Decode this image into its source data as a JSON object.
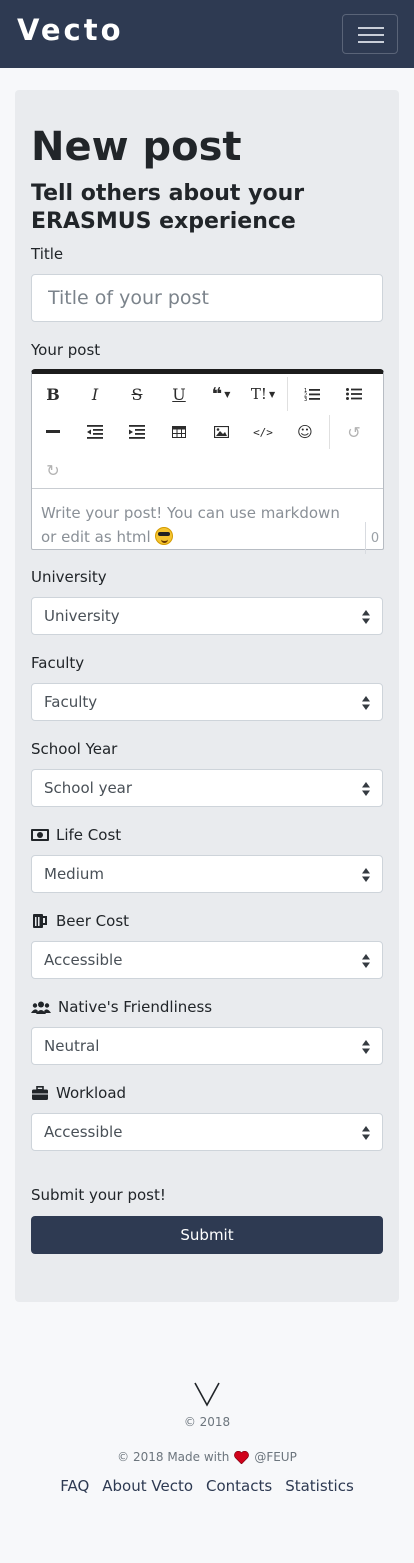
{
  "navbar": {
    "brand": "Vecto",
    "menu_icon": "hamburger-icon"
  },
  "page": {
    "title": "New post",
    "subtitle": "Tell others about your ERASMUS experience"
  },
  "form": {
    "title_label": "Title",
    "title_placeholder": "Title of your post",
    "post_label": "Your post",
    "editor": {
      "toolbar_row1": [
        "bold-icon",
        "italic-icon",
        "strikethrough-icon",
        "underline-icon",
        "quote-dropdown-icon",
        "text-size-dropdown-icon",
        "ordered-list-icon",
        "unordered-list-icon"
      ],
      "toolbar_row2": [
        "horizontal-rule-icon",
        "outdent-icon",
        "indent-icon",
        "table-icon",
        "image-icon",
        "code-icon",
        "emoji-icon",
        "undo-icon"
      ],
      "toolbar_row3": [
        "redo-icon"
      ],
      "placeholder": "Write your post! You can use markdown or edit as html",
      "counter": "0"
    },
    "fields": [
      {
        "label": "University",
        "value": "University",
        "icon": ""
      },
      {
        "label": "Faculty",
        "value": "Faculty",
        "icon": ""
      },
      {
        "label": "School Year",
        "value": "School year",
        "icon": ""
      },
      {
        "label": "Life Cost",
        "value": "Medium",
        "icon": "money-bill-icon"
      },
      {
        "label": "Beer Cost",
        "value": "Accessible",
        "icon": "beer-mug-icon"
      },
      {
        "label": "Native's Friendliness",
        "value": "Neutral",
        "icon": "users-icon"
      },
      {
        "label": "Workload",
        "value": "Accessible",
        "icon": "briefcase-icon"
      }
    ],
    "submit_label": "Submit your post!",
    "submit_button": "Submit"
  },
  "footer": {
    "logo": "V",
    "copyright": "© 2018",
    "made_with_prefix": "© 2018 Made with",
    "made_with_suffix": "@FEUP",
    "heart_icon": "heart-icon",
    "links": [
      "FAQ",
      "About Vecto",
      "Contacts",
      "Statistics"
    ]
  },
  "colors": {
    "primary": "#2e3a52",
    "card": "#e9ebee",
    "background": "#f7f8fa",
    "heart": "#d0021b"
  }
}
